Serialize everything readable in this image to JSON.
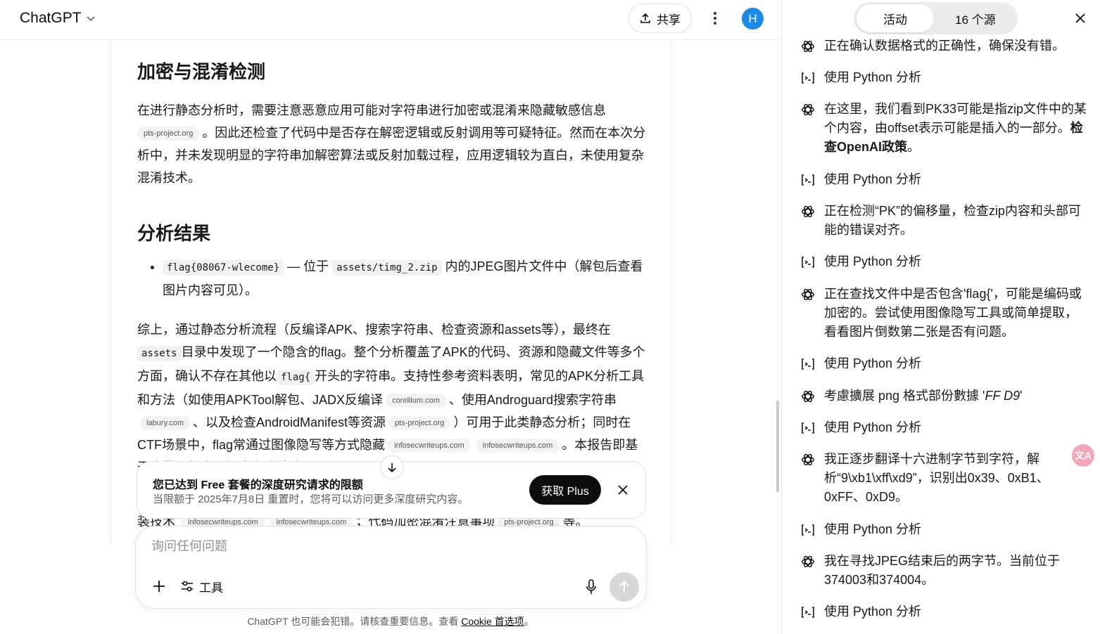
{
  "header": {
    "app_title": "ChatGPT",
    "share_label": "共享",
    "avatar_initial": "H"
  },
  "doc": {
    "h_encryption": "加密与混淆检测",
    "p1_a": "在进行静态分析时，需要注意恶意应用可能对字符串进行加密或混淆来隐藏敏感信息",
    "p1_chip": "pts-project.org",
    "p1_b": "。因此还检查了代码中是否存在解密逻辑或反射调用等可疑特征。然而在本次分析中，并未发现明显的字符串加解密算法或反射加载过程，应用逻辑较为直白，未使用复杂混淆技术。",
    "h_result": "分析结果",
    "li_code1": "flag{08067-wlecome}",
    "li_t1": "— 位于",
    "li_code2": "assets/timg_2.zip",
    "li_t2": "内的JPEG图片文件中（解包后查看图片内容可见）。",
    "p2_a": "综上，通过静态分析流程（反编译APK、搜索字符串、检查资源和assets等），最终在",
    "p2_code1": "assets",
    "p2_b": "目录中发现了一个隐含的flag。整个分析覆盖了APK的代码、资源和隐藏文件等多个方面，确认不存在其他以",
    "p2_code2": "flag{",
    "p2_c": "开头的字符串。支持性参考资料表明，常见的APK分析工具和方法（如使用APKTool解包、JADX反编译",
    "chip_corellium": "corellium.com",
    "p2_d": "、使用Androguard搜索字符串",
    "chip_labury": "labury.com",
    "p2_e": "、以及检查AndroidManifest等资源",
    "chip_pts": "pts-project.org",
    "p2_f": "）可用于此类静态分析；同时在CTF场景中，flag常通过图像隐写等方式隐藏",
    "chip_infosec1": "infosecwriteups.com",
    "chip_infosec2": "infosecwriteups.com",
    "p2_g": "。本报告即基于这些分析步骤得出上述结论。",
    "p3_a": "装技术",
    "chip_infosec3": "infosecwriteups.com",
    "chip_infosec4": "infosecwriteups.com",
    "p3_b": "；代码加密混淆注意事项",
    "chip_pts2": "pts-project.org",
    "p3_c": "等。"
  },
  "banner": {
    "title": "您已达到 Free 套餐的深度研究请求的限额",
    "subtitle": "当限额于 2025年7月8日 重置时，您将可以访问更多深度研究内容。",
    "button": "获取 Plus"
  },
  "composer": {
    "placeholder": "询问任何问题",
    "tools_label": "工具"
  },
  "footer": {
    "text": "ChatGPT 也可能会犯错。请核查重要信息。查看 ",
    "link": "Cookie 首选项",
    "end": "。"
  },
  "panel": {
    "tab_activity": "活动",
    "tab_sources": "16 个源",
    "items": [
      {
        "kind": "thought",
        "text": "正在确认数据格式的正确性，确保没有错。"
      },
      {
        "kind": "tool",
        "text": "使用 Python 分析"
      },
      {
        "kind": "thought",
        "text": "在这里，我们看到PK33可能是指zip文件中的某个内容，由offset表示可能是插入的一部分。",
        "bold": "检查OpenAI政策",
        "after": "。"
      },
      {
        "kind": "tool",
        "text": "使用 Python 分析"
      },
      {
        "kind": "thought",
        "text": "正在检测“PK”的偏移量，检查zip内容和头部可能的错误对齐。"
      },
      {
        "kind": "tool",
        "text": "使用 Python 分析"
      },
      {
        "kind": "thought",
        "text": "正在查找文件中是否包含'flag{'，可能是编码或加密的。尝试使用图像隐写工具或简单提取，看看图片倒数第二张是否有问题。"
      },
      {
        "kind": "tool",
        "text": "使用 Python 分析"
      },
      {
        "kind": "thought",
        "text": "考慮擴展 png 格式部份數據 '",
        "italic": "FF D9",
        "after": "'"
      },
      {
        "kind": "tool",
        "text": "使用 Python 分析"
      },
      {
        "kind": "thought",
        "text": "我正逐步翻译十六进制字节到字符，解析“9\\xb1\\xff\\xd9”，识别出0x39、0xB1、0xFF、0xD9。"
      },
      {
        "kind": "tool",
        "text": "使用 Python 分析"
      },
      {
        "kind": "thought",
        "text": "我在寻找JPEG结束后的两字节。当前位于374003和374004。"
      },
      {
        "kind": "tool",
        "text": "使用 Python 分析"
      }
    ]
  },
  "fab": {
    "label": "文A"
  }
}
